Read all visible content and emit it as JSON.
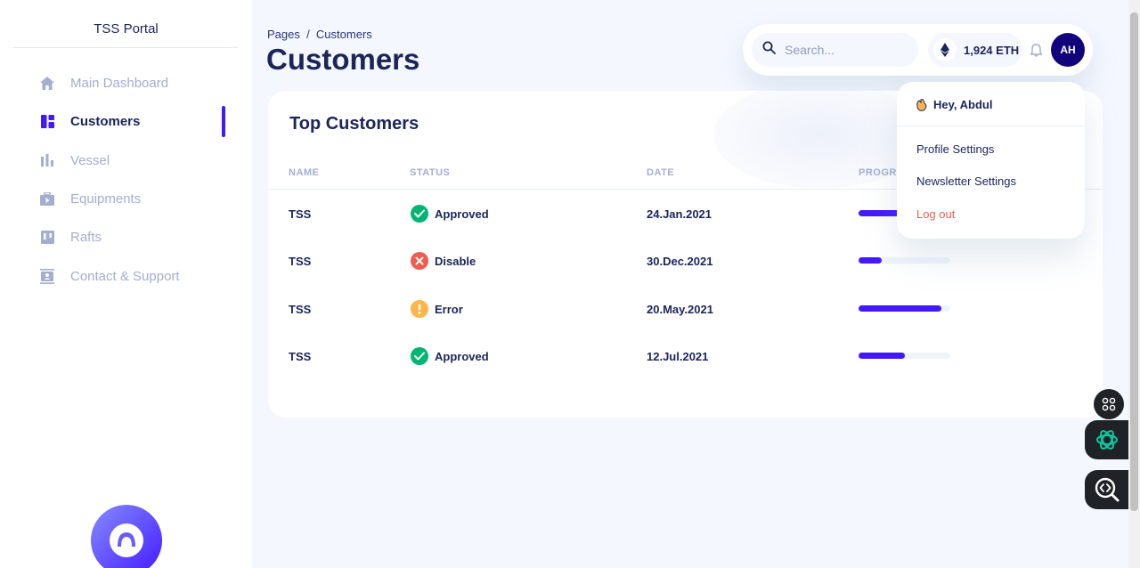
{
  "sidebar": {
    "brand": "TSS Portal",
    "items": [
      {
        "label": "Main Dashboard",
        "icon": "home-icon"
      },
      {
        "label": "Customers",
        "icon": "dashboard-grid-icon",
        "active": true
      },
      {
        "label": "Vessel",
        "icon": "bar-chart-icon"
      },
      {
        "label": "Equipments",
        "icon": "briefcase-play-icon"
      },
      {
        "label": "Rafts",
        "icon": "kanban-icon"
      },
      {
        "label": "Contact & Support",
        "icon": "contact-card-icon"
      }
    ]
  },
  "header": {
    "breadcrumb": "Pages  /  Customers",
    "title": "Customers",
    "search_placeholder": "Search...",
    "eth_balance": "1,924 ETH",
    "avatar_initials": "AH"
  },
  "dropdown": {
    "greeting": "Hey, Abdul",
    "items": [
      "Profile Settings",
      "Newsletter Settings",
      "Log out"
    ]
  },
  "table": {
    "title": "Top Customers",
    "columns": [
      "NAME",
      "STATUS",
      "DATE",
      "PROGRESS"
    ],
    "rows": [
      {
        "name": "TSS",
        "status": "Approved",
        "status_type": "success",
        "date": "24.Jan.2021",
        "progress": 0.75
      },
      {
        "name": "TSS",
        "status": "Disable",
        "status_type": "error",
        "date": "30.Dec.2021",
        "progress": 0.25
      },
      {
        "name": "TSS",
        "status": "Error",
        "status_type": "warning",
        "date": "20.May.2021",
        "progress": 0.9
      },
      {
        "name": "TSS",
        "status": "Approved",
        "status_type": "success",
        "date": "12.Jul.2021",
        "progress": 0.5
      }
    ]
  },
  "colors": {
    "accent": "#4318ff",
    "navy": "#1b2559",
    "muted": "#a3aed0",
    "success": "#01b574",
    "error": "#ee5d50",
    "warning": "#ffb547",
    "background": "#f4f7fe"
  }
}
